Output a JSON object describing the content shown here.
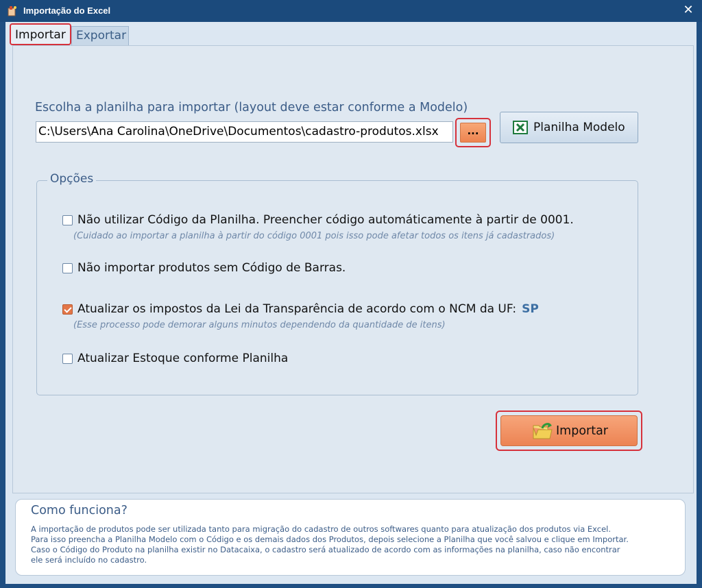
{
  "window": {
    "title": "Importação do Excel",
    "close_glyph": "✕"
  },
  "tabs": [
    {
      "label": "Importar",
      "active": true
    },
    {
      "label": "Exportar",
      "active": false
    }
  ],
  "import_panel": {
    "file_label": "Escolha a planilha para importar (layout deve estar conforme a Modelo)",
    "file_path": "C:\\Users\\Ana Carolina\\OneDrive\\Documentos\\cadastro-produtos.xlsx",
    "browse_label": "...",
    "modelo_button_label": "Planilha Modelo",
    "options_legend": "Opções",
    "options": [
      {
        "label": "Não utilizar Código da Planilha. Preencher código automáticamente à partir de 0001.",
        "note": "(Cuidado ao importar a planilha à partir do código 0001 pois isso pode afetar todos os itens já cadastrados)",
        "checked": false
      },
      {
        "label": "Não importar produtos sem Código de Barras.",
        "checked": false
      },
      {
        "label": "Atualizar os impostos da Lei da Transparência de acordo com o NCM da UF:",
        "uf": "SP",
        "note": "(Esse processo pode demorar alguns minutos dependendo da quantidade de itens)",
        "checked": true
      },
      {
        "label": "Atualizar Estoque conforme Planilha",
        "checked": false
      }
    ],
    "import_button_label": "Importar"
  },
  "help": {
    "title": "Como funciona?",
    "lines": [
      "A importação de produtos pode ser utilizada tanto para migração do cadastro de outros softwares quanto para atualização dos produtos via Excel.",
      "Para isso preencha a Planilha Modelo com o Código e os demais dados dos Produtos, depois selecione a Planilha que você salvou e clique em Importar.",
      "Caso o Código do Produto na planilha existir no Datacaixa, o cadastro será atualizado de acordo com as informações na planilha, caso não encontrar",
      "ele será incluído no cadastro."
    ]
  },
  "colors": {
    "title_bar": "#1b4a7c",
    "accent_orange": "#ec8353",
    "highlight_red": "#d6313b",
    "label_blue": "#3b5c87"
  },
  "icons": {
    "app": "app-icon",
    "close": "close-icon",
    "excel": "excel-icon",
    "import": "folder-arrow-icon"
  }
}
